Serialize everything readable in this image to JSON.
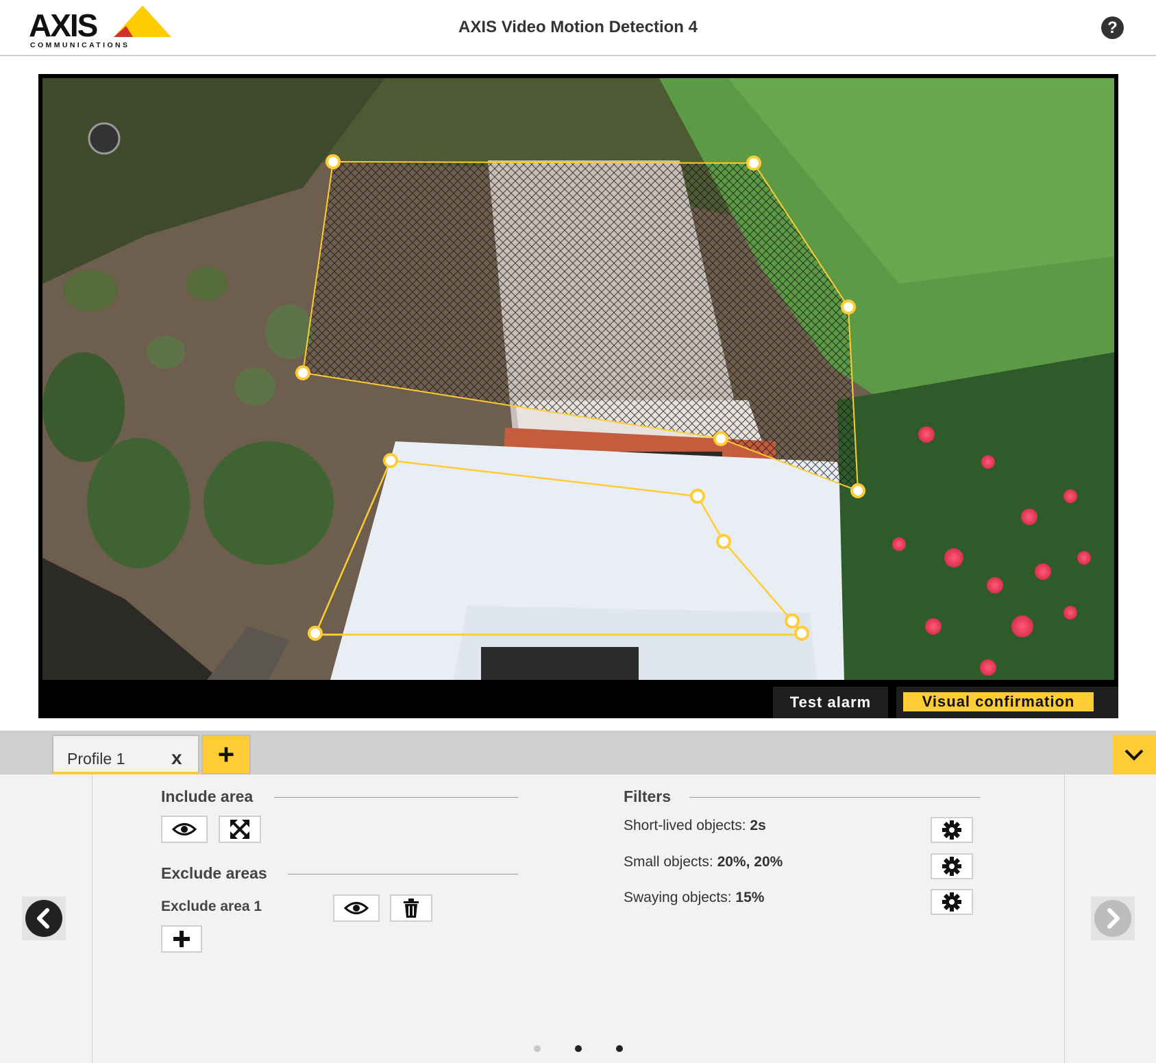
{
  "header": {
    "logo_text": "AXIS",
    "logo_subtext": "COMMUNICATIONS",
    "title": "AXIS Video Motion Detection 4",
    "help_label": "?"
  },
  "video": {
    "test_alarm_label": "Test alarm",
    "visual_confirmation_label": "Visual confirmation"
  },
  "profiles": {
    "tabs": [
      {
        "label": "Profile 1",
        "close_label": "x"
      }
    ],
    "add_label": "+"
  },
  "include_area": {
    "title": "Include area",
    "buttons": [
      "eye-icon",
      "maximize-icon"
    ]
  },
  "exclude_areas": {
    "title": "Exclude areas",
    "items": [
      {
        "label": "Exclude area 1"
      }
    ],
    "add_label": "+"
  },
  "filters": {
    "title": "Filters",
    "items": [
      {
        "label": "Short-lived objects: ",
        "value": "2s"
      },
      {
        "label": "Small objects: ",
        "value": "20%, 20%"
      },
      {
        "label": "Swaying objects: ",
        "value": "15%"
      }
    ]
  },
  "pagination": {
    "pages": 3,
    "current": 1
  },
  "colors": {
    "accent": "#ffcc33",
    "dark": "#333333",
    "panel": "#f2f2f2"
  }
}
